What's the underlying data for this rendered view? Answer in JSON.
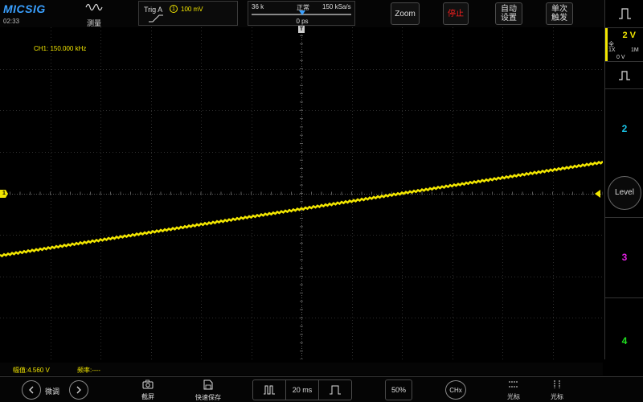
{
  "header": {
    "brand": "MICSIG",
    "clock": "02:33",
    "measure_label": "测量",
    "trigger": {
      "title": "Trig  A",
      "channel": "1",
      "level": "100 mV"
    },
    "timebase": {
      "memory": "36 k",
      "mode": "正常",
      "sample_rate": "150 kSa/s",
      "delay": "0 ps"
    },
    "buttons": {
      "zoom": "Zoom",
      "stop": "停止",
      "auto_line1": "自动",
      "auto_line2": "设置",
      "single_line1": "单次",
      "single_line2": "触发"
    }
  },
  "screen": {
    "ch1_frequency": "CH1: 150.000 kHz",
    "ch1_marker": "1",
    "top_marker": "T"
  },
  "right_panel": {
    "ch1": {
      "vdiv": "2 V",
      "bw": "全",
      "coupling": "1X",
      "probe": "1M",
      "offset": "0 V"
    },
    "ch2": "2",
    "level_label": "Level",
    "ch3": "3",
    "ch4": "4",
    "colors": {
      "ch1": "#f2e600",
      "ch2": "#19c3e6",
      "ch3": "#e020e0",
      "ch4": "#20e020"
    }
  },
  "measurements": {
    "amplitude": "幅值:4.560 V",
    "frequency": "频率:----"
  },
  "bottom": {
    "finetune_label": "微调",
    "screenshot_label": "截屏",
    "quicksave_label": "快速保存",
    "timebase_value": "20 ms",
    "percent_label": "50%",
    "chx_label": "CHx",
    "cursor_h_label": "光标",
    "cursor_v_label": "光标"
  },
  "waveform": {
    "color": "#f2e600",
    "start_level_div": -1.5,
    "end_level_div": 0.75
  }
}
